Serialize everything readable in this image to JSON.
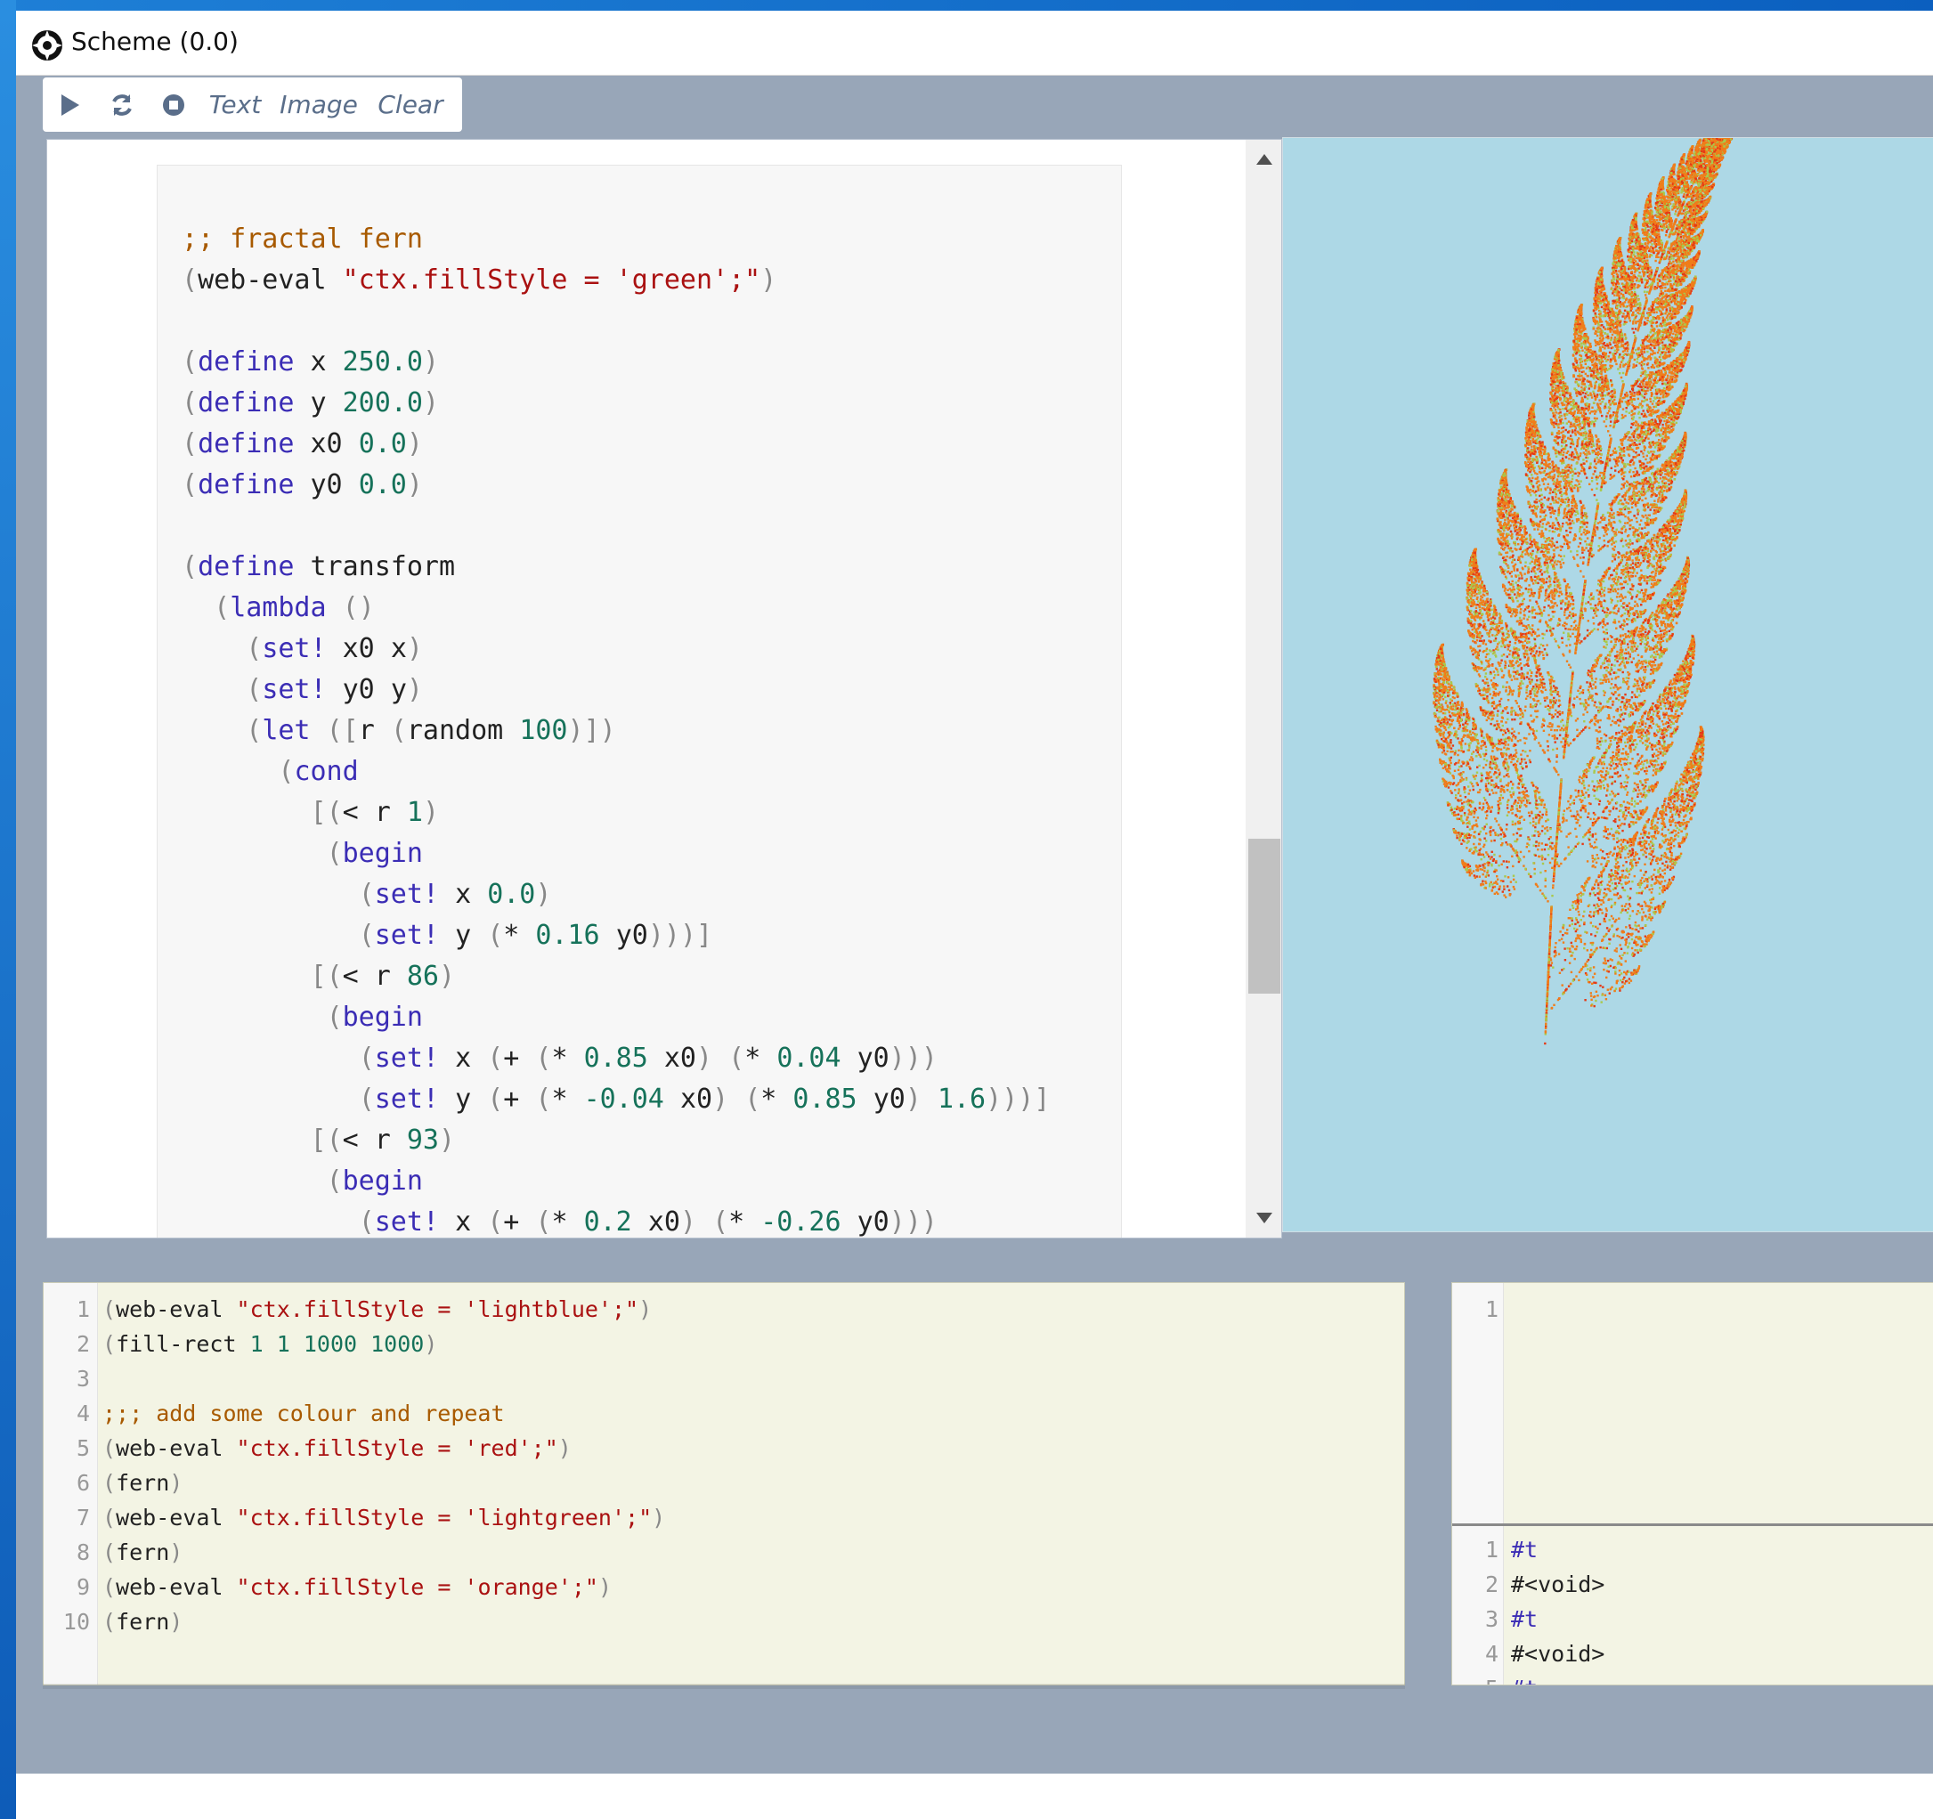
{
  "window": {
    "title": "Scheme (0.0)"
  },
  "toolbar": {
    "run_icon": "play-icon",
    "reload_icon": "refresh-icon",
    "stop_icon": "stop-icon",
    "text_label": "Text",
    "image_label": "Image",
    "clear_label": "Clear"
  },
  "colors": {
    "window_bg": "#98a6b8",
    "canvas_bg": "#add8e6",
    "repl_bg": "#f3f4e4",
    "comment": "#a85a00",
    "string": "#aa1111",
    "number": "#16725a",
    "keyword": "#3b2db5",
    "fern_main": "#f07d1a",
    "fern_speckle_red": "#e53a16",
    "fern_speckle_green": "#a9c94c"
  },
  "editor": {
    "code_lines": [
      ";; fractal fern",
      "(web-eval \"ctx.fillStyle = 'green';\")",
      "",
      "(define x 250.0)",
      "(define y 200.0)",
      "(define x0 0.0)",
      "(define y0 0.0)",
      "",
      "(define transform",
      "  (lambda ()",
      "    (set! x0 x)",
      "    (set! y0 y)",
      "    (let ([r (random 100)])",
      "      (cond",
      "        [(< r 1)",
      "         (begin",
      "           (set! x 0.0)",
      "           (set! y (* 0.16 y0)))]",
      "        [(< r 86)",
      "         (begin",
      "           (set! x (+ (* 0.85 x0) (* 0.04 y0)))",
      "           (set! y (+ (* -0.04 x0) (* 0.85 y0) 1.6)))]",
      "        [(< r 93)",
      "         (begin",
      "           (set! x (+ (* 0.2 x0) (* -0.26 y0)))"
    ]
  },
  "repl": {
    "lines": [
      "(web-eval \"ctx.fillStyle = 'lightblue';\")",
      "(fill-rect 1 1 1000 1000)",
      "",
      ";;; add some colour and repeat",
      "(web-eval \"ctx.fillStyle = 'red';\")",
      "(fern)",
      "(web-eval \"ctx.fillStyle = 'lightgreen';\")",
      "(fern)",
      "(web-eval \"ctx.fillStyle = 'orange';\")",
      "(fern)"
    ]
  },
  "output": {
    "top_lines": [
      "1"
    ],
    "results": [
      "#t",
      "#<void>",
      "#t",
      "#<void>",
      "#t"
    ]
  }
}
